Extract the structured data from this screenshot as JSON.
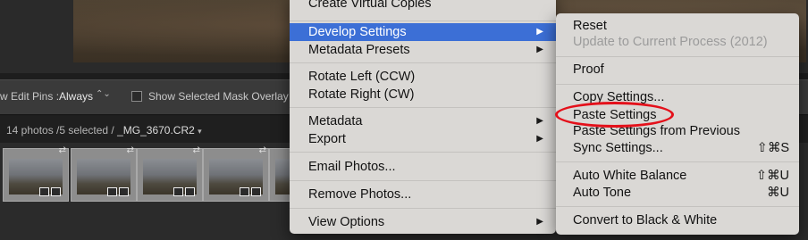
{
  "toolbar": {
    "show_edit_pins_label": "w Edit Pins :",
    "show_edit_pins_value": "Always",
    "show_mask_overlay_label": "Show Selected Mask Overlay"
  },
  "filmstrip": {
    "count_text": "14 photos /5 selected /",
    "filename": "_MG_3670.CR2",
    "dropdown_icon": "triangle-down-icon"
  },
  "context_menu": {
    "items": [
      {
        "label": "Create Virtual Copies"
      },
      {
        "label": "Develop Settings",
        "has_submenu": true,
        "highlighted": true
      },
      {
        "label": "Metadata Presets",
        "has_submenu": true
      },
      {
        "label": "Rotate Left (CCW)"
      },
      {
        "label": "Rotate Right (CW)"
      },
      {
        "label": "Metadata",
        "has_submenu": true
      },
      {
        "label": "Export",
        "has_submenu": true
      },
      {
        "label": "Email Photos..."
      },
      {
        "label": "Remove Photos..."
      },
      {
        "label": "View Options",
        "has_submenu": true
      }
    ]
  },
  "develop_submenu": {
    "items": [
      {
        "label": "Reset"
      },
      {
        "label": "Update to Current Process (2012)",
        "disabled": true
      },
      {
        "label": "Proof"
      },
      {
        "label": "Copy Settings..."
      },
      {
        "label": "Paste Settings"
      },
      {
        "label": "Paste Settings from Previous"
      },
      {
        "label": "Sync Settings...",
        "shortcut": "⇧⌘S"
      },
      {
        "label": "Auto White Balance",
        "shortcut": "⇧⌘U"
      },
      {
        "label": "Auto Tone",
        "shortcut": "⌘U"
      },
      {
        "label": "Convert to Black & White"
      }
    ]
  },
  "glyphs": {
    "submenu_arrow": "▶",
    "stepper": "⌃⌄",
    "photo_corner": "⇄"
  },
  "colors": {
    "menu_background": "#dad8d5",
    "highlight": "#3c6fd6",
    "annotation": "#e4101a"
  }
}
